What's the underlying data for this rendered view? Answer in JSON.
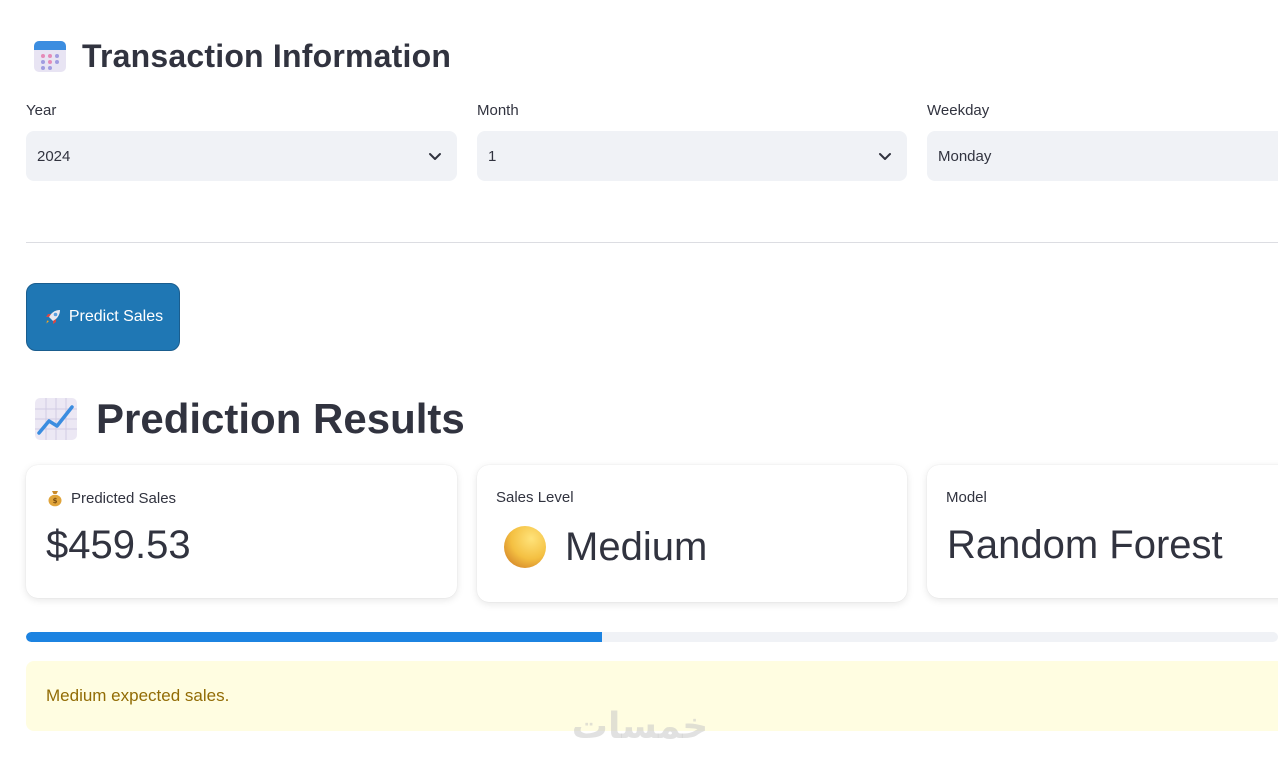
{
  "transaction": {
    "title": "Transaction Information",
    "icon": "calendar-icon",
    "fields": [
      {
        "label": "Year",
        "value": "2024"
      },
      {
        "label": "Month",
        "value": "1"
      },
      {
        "label": "Weekday",
        "value": "Monday"
      }
    ]
  },
  "actions": {
    "predict_label": "Predict Sales",
    "predict_icon": "rocket-icon"
  },
  "results": {
    "title": "Prediction Results",
    "icon": "chart-increasing-icon",
    "metrics": [
      {
        "label": "Predicted Sales",
        "value": "$459.53",
        "icon": "money-bag-icon"
      },
      {
        "label": "Sales Level",
        "value": "Medium",
        "icon": "yellow-circle-icon"
      },
      {
        "label": "Model",
        "value": "Random Forest"
      }
    ],
    "progress_percent": 46,
    "message": "Medium expected sales."
  },
  "watermark": "خمسات",
  "colors": {
    "primary_button": "#1f77b4",
    "progress_fill": "#1c83e1",
    "warning_bg": "#fffde1",
    "warning_text": "#926c05",
    "input_bg": "#f0f2f6"
  }
}
